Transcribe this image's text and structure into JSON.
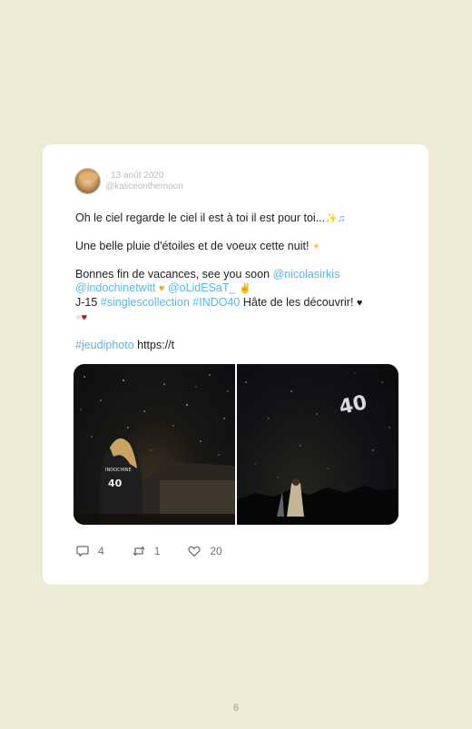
{
  "tweet": {
    "date": "· 13 août 2020",
    "handle": "@kaliceonthemoon",
    "line1": "Oh le ciel regarde le ciel il est à toi il est pour toi...",
    "line2": "Une belle pluie d'étoiles et de voeux cette nuit!",
    "line3_text": "Bonnes fin de vacances, see you soon ",
    "mention1": "@nicolasirkis",
    "mention2": "@indochinetwitt",
    "mention3": "@oLidESaT_",
    "line5_prefix": "J-15 ",
    "hashtag1": "#singlescollection",
    "hashtag2": "#INDO40",
    "line5_suffix": " Hâte de les découvrir!",
    "hashtag3": "#jeudiphoto",
    "url_fragment": " https://t",
    "jersey_text": "INDOCHINE",
    "photo_logo": "40"
  },
  "actions": {
    "replies": "4",
    "retweets": "1",
    "likes": "20"
  },
  "page": {
    "number": "6"
  },
  "colors": {
    "link": "#5ab6e8",
    "background": "#eeecd6"
  }
}
